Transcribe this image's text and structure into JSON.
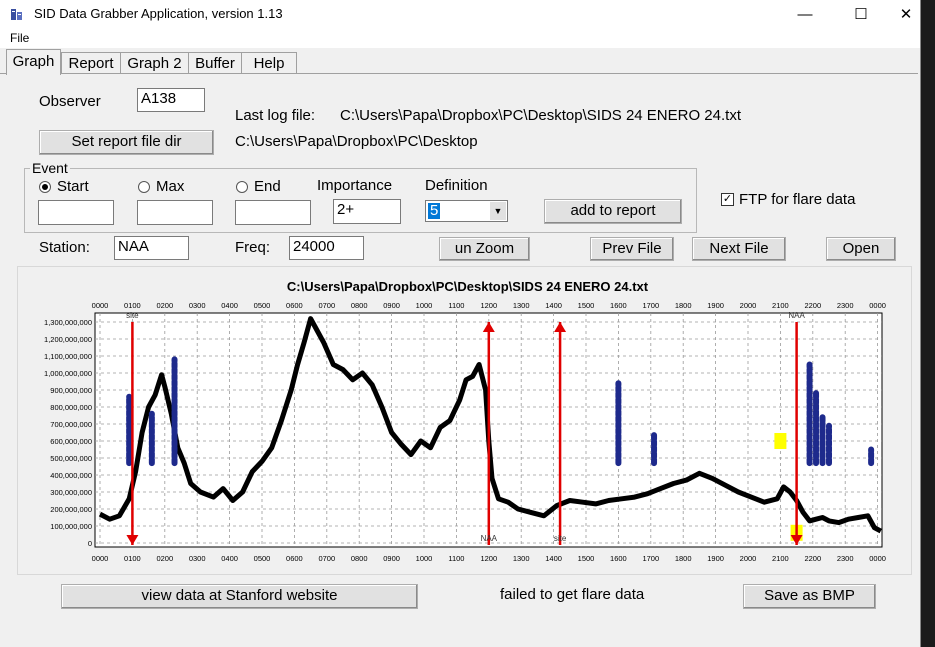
{
  "window": {
    "title": "SID Data Grabber Application, version 1.13",
    "minimize_glyph": "—",
    "maximize_glyph": "☐",
    "close_glyph": "✕"
  },
  "menu": {
    "file_label": "File"
  },
  "tabs": [
    "Graph",
    "Report",
    "Graph 2",
    "Buffer",
    "Help"
  ],
  "form": {
    "observer_label": "Observer",
    "observer_value": "A138",
    "last_log_label": "Last log file:",
    "last_log_value": "C:\\Users\\Papa\\Dropbox\\PC\\Desktop\\SIDS 24 ENERO 24.txt",
    "report_dir_value": "C:\\Users\\Papa\\Dropbox\\PC\\Desktop",
    "set_report_button": "Set report file dir",
    "event_legend": "Event",
    "start_label": "Start",
    "max_label": "Max",
    "end_label": "End",
    "start_value": "",
    "max_value": "",
    "end_value": "",
    "importance_label": "Importance",
    "importance_value": "2+",
    "definition_label": "Definition",
    "definition_value": "5",
    "add_report_button": "add to report",
    "ftp_label": "FTP for flare data",
    "ftp_checked": true,
    "station_label": "Station:",
    "station_value": "NAA",
    "freq_label": "Freq:",
    "freq_value": "24000",
    "unzoom_button": "un Zoom",
    "prev_button": "Prev File",
    "next_button": "Next File",
    "open_button": "Open"
  },
  "footer": {
    "stanford_button": "view data at Stanford website",
    "status_text": "failed to get flare data",
    "save_button": "Save as BMP"
  },
  "colors": {
    "signal": "#000000",
    "spikes": "#1e2a8c",
    "markers": "#e00000",
    "highlight": "#ffff00"
  },
  "chart_data": {
    "type": "line",
    "title": "C:\\Users\\Papa\\Dropbox\\PC\\Desktop\\SIDS 24 ENERO 24.txt",
    "x_ticks": [
      "0000",
      "0100",
      "0200",
      "0300",
      "0400",
      "0500",
      "0600",
      "0700",
      "0800",
      "0900",
      "1000",
      "1100",
      "1200",
      "1300",
      "1400",
      "1500",
      "1600",
      "1700",
      "1800",
      "1900",
      "2000",
      "2100",
      "2200",
      "2300",
      "0000"
    ],
    "y_ticks": [
      "0",
      "100,000,000",
      "200,000,000",
      "300,000,000",
      "400,000,000",
      "500,000,000",
      "600,000,000",
      "700,000,000",
      "800,000,000",
      "900,000,000",
      "1,000,000,000",
      "1,100,000,000",
      "1,200,000,000",
      "1,300,000,000"
    ],
    "ylim": [
      0,
      1380000000
    ],
    "xlim_hours": [
      0,
      24.2
    ],
    "grid": true,
    "signal": {
      "hours": [
        0,
        0.3,
        0.6,
        0.9,
        1.1,
        1.3,
        1.5,
        1.7,
        1.9,
        2.0,
        2.2,
        2.4,
        2.6,
        2.8,
        3.1,
        3.5,
        3.8,
        4.1,
        4.4,
        4.7,
        5.0,
        5.3,
        5.6,
        5.9,
        6.1,
        6.3,
        6.5,
        6.7,
        6.9,
        7.2,
        7.5,
        7.8,
        8.1,
        8.4,
        8.7,
        9.0,
        9.3,
        9.6,
        9.9,
        10.2,
        10.5,
        10.8,
        11.1,
        11.3,
        11.5,
        11.7,
        11.9,
        12.0,
        12.1,
        12.3,
        12.6,
        12.9,
        13.3,
        13.7,
        14.1,
        14.5,
        14.9,
        15.3,
        15.7,
        16.1,
        16.5,
        16.9,
        17.3,
        17.7,
        18.1,
        18.5,
        18.9,
        19.3,
        19.7,
        20.1,
        20.5,
        20.9,
        21.1,
        21.3,
        21.5,
        21.7,
        21.9,
        22.1,
        22.3,
        22.5,
        22.8,
        23.1,
        23.4,
        23.7,
        23.9,
        24.1
      ],
      "values": [
        170000000,
        140000000,
        160000000,
        260000000,
        420000000,
        650000000,
        800000000,
        870000000,
        990000000,
        920000000,
        760000000,
        560000000,
        470000000,
        350000000,
        300000000,
        270000000,
        320000000,
        250000000,
        300000000,
        420000000,
        480000000,
        560000000,
        720000000,
        900000000,
        1050000000,
        1180000000,
        1320000000,
        1250000000,
        1180000000,
        1050000000,
        1020000000,
        960000000,
        1000000000,
        930000000,
        800000000,
        650000000,
        580000000,
        520000000,
        600000000,
        560000000,
        680000000,
        720000000,
        840000000,
        960000000,
        980000000,
        1050000000,
        900000000,
        600000000,
        380000000,
        260000000,
        240000000,
        200000000,
        180000000,
        160000000,
        220000000,
        250000000,
        240000000,
        230000000,
        250000000,
        260000000,
        270000000,
        290000000,
        320000000,
        350000000,
        370000000,
        410000000,
        380000000,
        340000000,
        300000000,
        270000000,
        240000000,
        260000000,
        330000000,
        300000000,
        250000000,
        180000000,
        130000000,
        140000000,
        150000000,
        130000000,
        120000000,
        140000000,
        150000000,
        160000000,
        90000000,
        70000000
      ]
    },
    "spikes": [
      {
        "hour": 0.9,
        "value": 860000000
      },
      {
        "hour": 1.6,
        "value": 760000000
      },
      {
        "hour": 2.3,
        "value": 1080000000
      },
      {
        "hour": 16.0,
        "value": 940000000
      },
      {
        "hour": 17.1,
        "value": 640000000
      },
      {
        "hour": 21.9,
        "value": 1050000000
      },
      {
        "hour": 22.1,
        "value": 890000000
      },
      {
        "hour": 22.3,
        "value": 740000000
      },
      {
        "hour": 22.5,
        "value": 690000000
      },
      {
        "hour": 23.8,
        "value": 550000000
      }
    ],
    "markers": [
      {
        "hour": 1.0,
        "direction": "down",
        "label": "site",
        "label_pos": "top"
      },
      {
        "hour": 12.0,
        "direction": "up",
        "label": "NAA",
        "label_pos": "bottom"
      },
      {
        "hour": 14.2,
        "direction": "up",
        "label": "site",
        "label_pos": "bottom"
      },
      {
        "hour": 21.5,
        "direction": "down",
        "label": "NAA",
        "label_pos": "top"
      }
    ],
    "highlights": [
      {
        "hour": 21.0,
        "value": 600000000
      },
      {
        "hour": 21.5,
        "value": 60000000
      }
    ]
  }
}
